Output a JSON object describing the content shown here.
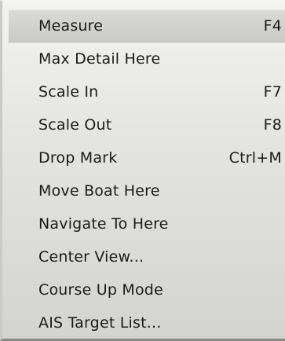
{
  "context_menu": {
    "items": [
      {
        "label": "Measure",
        "shortcut": "F4",
        "highlighted": true
      },
      {
        "label": "Max Detail Here",
        "shortcut": ""
      },
      {
        "label": "Scale In",
        "shortcut": "F7"
      },
      {
        "label": "Scale Out",
        "shortcut": "F8"
      },
      {
        "label": "Drop Mark",
        "shortcut": "Ctrl+M"
      },
      {
        "label": "Move Boat Here",
        "shortcut": ""
      },
      {
        "label": "Navigate To Here",
        "shortcut": ""
      },
      {
        "label": "Center View...",
        "shortcut": ""
      },
      {
        "label": "Course Up Mode",
        "shortcut": ""
      },
      {
        "label": "AIS Target List...",
        "shortcut": ""
      }
    ]
  }
}
